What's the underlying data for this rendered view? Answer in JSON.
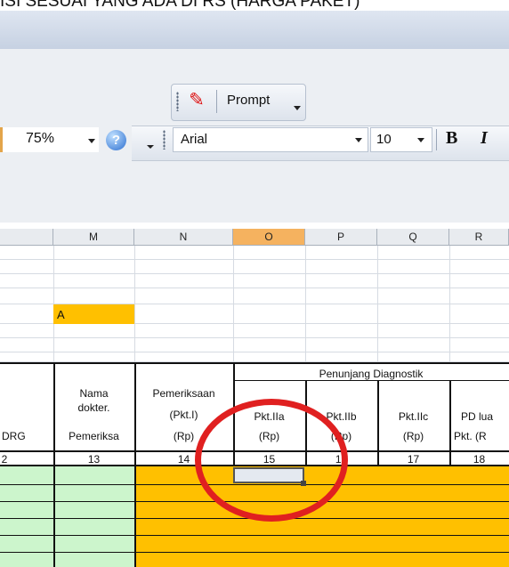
{
  "title_strip_text": "ISI SESUAI YANG ADA DI RS (HARGA PAKET)",
  "prompt_toolbar": {
    "icon": "pdf-icon",
    "label": "Prompt"
  },
  "formatting_toolbar": {
    "zoom": "75%",
    "help_symbol": "?",
    "font": "Arial",
    "font_size": "10",
    "bold": "B",
    "italic": "I"
  },
  "columns": [
    "M",
    "N",
    "O",
    "P",
    "Q",
    "R"
  ],
  "selected_column": "O",
  "cell_value_A": "A",
  "group_header": "Penunjang Diagnostik",
  "headers": {
    "col_l": "DRG",
    "col_m": [
      "Nama",
      "dokter.",
      "Pemeriksa"
    ],
    "col_n": [
      "Pemeriksaan",
      "(Pkt.I)",
      "(Rp)"
    ],
    "col_o": [
      "Pkt.IIa",
      "(Rp)"
    ],
    "col_p": [
      "Pkt.IIb",
      "(Rp)"
    ],
    "col_q": [
      "Pkt.IIc",
      "(Rp)"
    ],
    "col_r": [
      "PD lua",
      "Pkt.  (R"
    ]
  },
  "numbers": [
    "2",
    "13",
    "14",
    "15",
    "16",
    "17",
    "18"
  ],
  "colors": {
    "yellow": "#ffc000",
    "green": "#ccf5cc",
    "selected_header": "#f5b25f",
    "annotation": "#e02020"
  }
}
